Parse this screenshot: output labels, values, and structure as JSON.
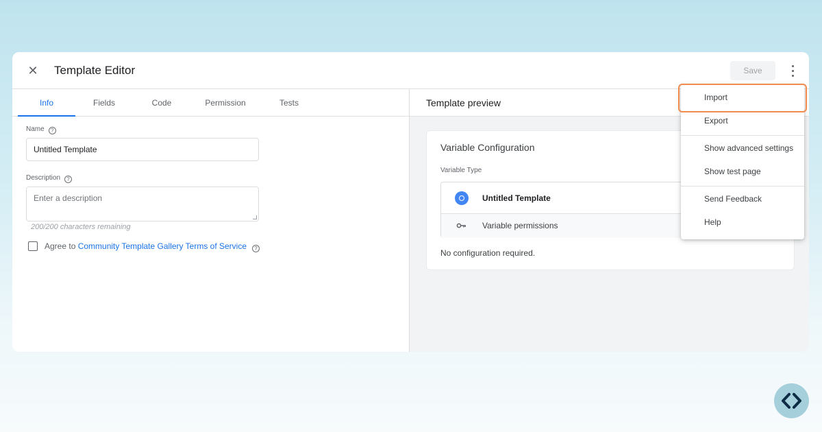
{
  "editor": {
    "title": "Template Editor",
    "save_label": "Save"
  },
  "tabs": [
    {
      "label": "Info",
      "active": true
    },
    {
      "label": "Fields"
    },
    {
      "label": "Code"
    },
    {
      "label": "Permission"
    },
    {
      "label": "Tests"
    }
  ],
  "info": {
    "name_label": "Name",
    "name_value": "Untitled Template",
    "description_label": "Description",
    "description_placeholder": "Enter a description",
    "chars_remaining": "200/200 characters remaining",
    "agree_prefix": "Agree to ",
    "agree_link": "Community Template Gallery Terms of Service"
  },
  "preview": {
    "header": "Template preview",
    "card_title": "Variable Configuration",
    "variable_type_label": "Variable Type",
    "variable_name": "Untitled Template",
    "permissions_label": "Variable permissions",
    "no_config": "No configuration required."
  },
  "menu": {
    "items": [
      {
        "label": "Import",
        "highlighted": true
      },
      {
        "label": "Export"
      },
      {
        "label": "Show advanced settings"
      },
      {
        "label": "Show test page"
      },
      {
        "label": "Send Feedback"
      },
      {
        "label": "Help"
      }
    ]
  },
  "colors": {
    "accent": "#1a73e8",
    "highlight": "#f08c4d",
    "gear": "#4285f4"
  },
  "icons": [
    "close-icon",
    "kebab-menu-icon",
    "help-icon",
    "gear-icon",
    "key-icon",
    "code-brackets-icon"
  ]
}
